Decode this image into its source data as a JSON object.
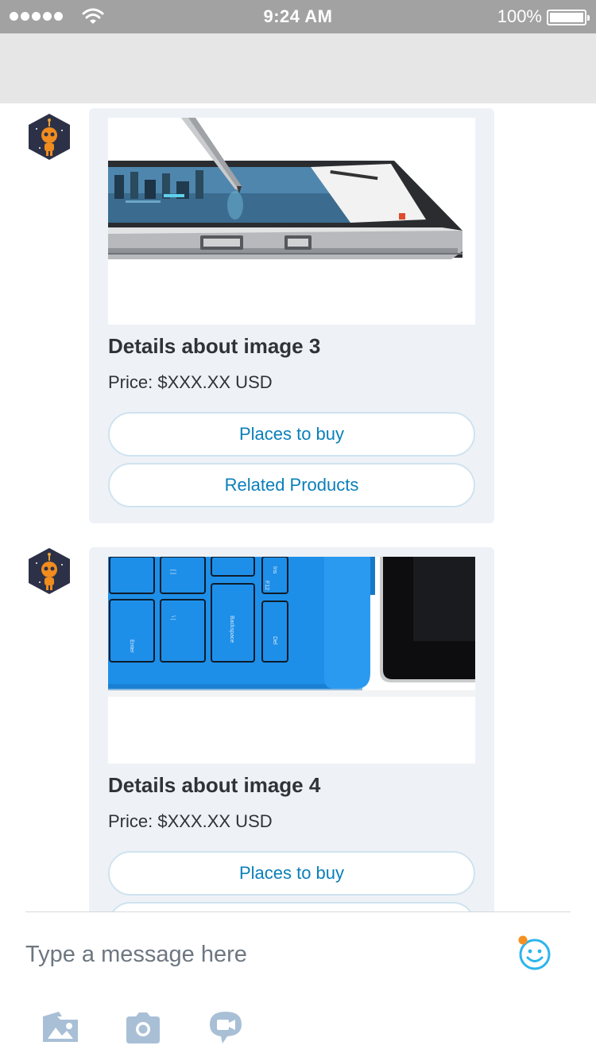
{
  "status_bar": {
    "time": "9:24 AM",
    "battery_percent": "100%",
    "signal_dots": 5,
    "battery_level": 1.0
  },
  "messages": [
    {
      "type": "product-card",
      "image_icon": "surface-tablet-with-pen-photo",
      "title": "Details about image 3",
      "price": "Price: $XXX.XX USD",
      "buttons": [
        "Places to buy",
        "Related Products"
      ]
    },
    {
      "type": "product-card",
      "image_icon": "blue-keyboard-cover-photo",
      "title": "Details about image 4",
      "price": "Price: $XXX.XX USD",
      "buttons": [
        "Places to buy"
      ]
    }
  ],
  "composer": {
    "placeholder": "Type a message here",
    "icons": [
      "emoji-icon",
      "image-gallery-icon",
      "camera-icon",
      "video-message-icon"
    ]
  },
  "colors": {
    "status_bar": "#a2a2a2",
    "header": "#e6e6e6",
    "card_background": "#eef2f7",
    "button_text": "#0a7fba",
    "button_border": "#cfe3ef",
    "accent_dot": "#f7901e",
    "emoji_blue": "#2cb5ec",
    "toolbar_icon": "#a8bfd6"
  }
}
